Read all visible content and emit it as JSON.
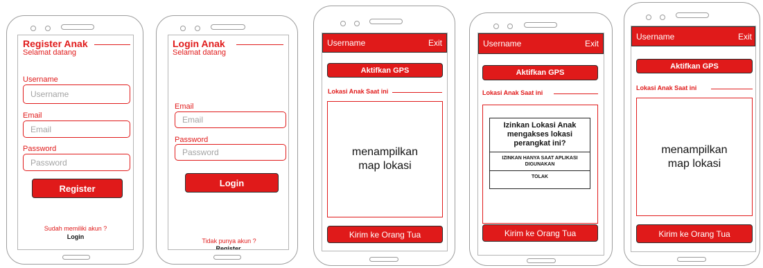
{
  "phones": {
    "register": {
      "title": "Register Anak",
      "subtitle": "Selamat datang",
      "username_label": "Username",
      "username_placeholder": "Username",
      "email_label": "Email",
      "email_placeholder": "Email",
      "password_label": "Password",
      "password_placeholder": "Password",
      "button": "Register",
      "footer_text": "Sudah memiliki akun ?",
      "footer_link": "Login"
    },
    "login": {
      "title": "Login Anak",
      "subtitle": "Selamat datang",
      "email_label": "Email",
      "email_placeholder": "Email",
      "password_label": "Password",
      "password_placeholder": "Password",
      "button": "Login",
      "footer_text": "Tidak punya akun ?",
      "footer_link": "Register"
    },
    "map1": {
      "header_user": "Username",
      "header_exit": "Exit",
      "gps_button": "Aktifkan GPS",
      "section_label": "Lokasi Anak Saat ini",
      "map_text_1": "menampilkan",
      "map_text_2": "map lokasi",
      "send_button": "Kirim ke Orang Tua"
    },
    "map2": {
      "header_user": "Username",
      "header_exit": "Exit",
      "gps_button": "Aktifkan GPS",
      "section_label": "Lokasi Anak Saat ini",
      "dialog_line_1": "Izinkan Lokasi Anak",
      "dialog_line_2": "mengakses lokasi",
      "dialog_line_3": "perangkat ini?",
      "dialog_allow_1": "IZINKAN HANYA SAAT APLIKASI",
      "dialog_allow_2": "DIGUNAKAN",
      "dialog_deny": "TOLAK",
      "send_button": "Kirim ke Orang Tua"
    },
    "map3": {
      "header_user": "Username",
      "header_exit": "Exit",
      "gps_button": "Aktifkan GPS",
      "section_label": "Lokasi Anak Saat ini",
      "map_text_1": "menampilkan",
      "map_text_2": "map lokasi",
      "send_button": "Kirim ke Orang Tua"
    }
  },
  "colors": {
    "accent": "#e01a1a",
    "border": "#9c9c9c",
    "outline": "#2b2b2b"
  }
}
